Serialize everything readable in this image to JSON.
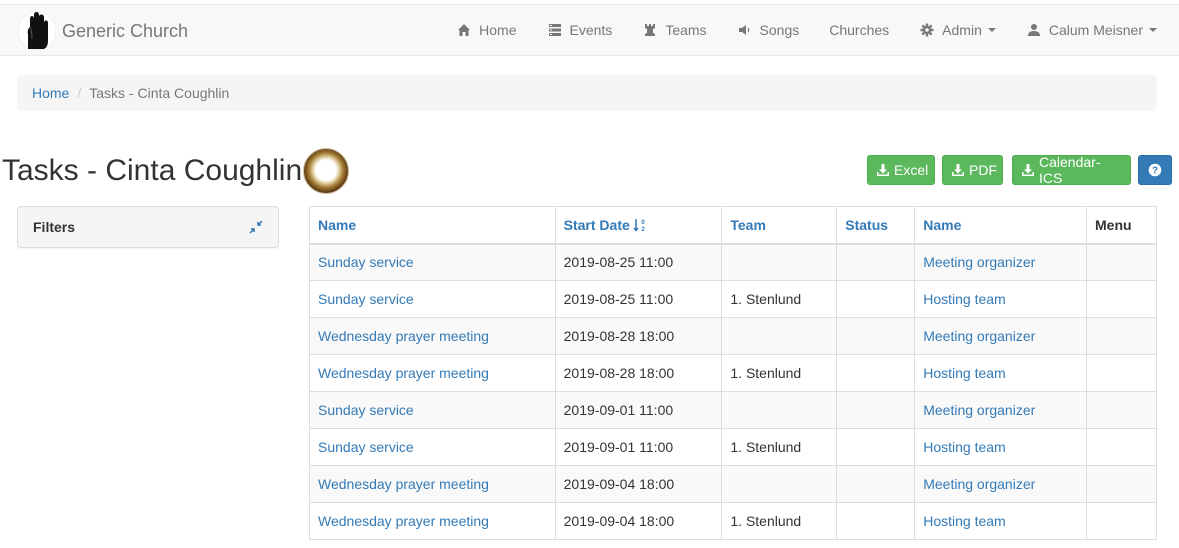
{
  "brand": {
    "name": "Generic Church"
  },
  "nav": {
    "items": [
      {
        "label": "Home",
        "icon": "home-icon"
      },
      {
        "label": "Events",
        "icon": "events-icon"
      },
      {
        "label": "Teams",
        "icon": "rook-icon"
      },
      {
        "label": "Songs",
        "icon": "volume-icon"
      },
      {
        "label": "Churches",
        "icon": ""
      },
      {
        "label": "Admin",
        "icon": "gear-icon"
      },
      {
        "label": "Calum Meisner",
        "icon": "user-icon"
      }
    ]
  },
  "breadcrumb": {
    "home": "Home",
    "current": "Tasks - Cinta Coughlin"
  },
  "page": {
    "title": "Tasks - Cinta Coughlin"
  },
  "buttons": {
    "excel": "Excel",
    "pdf": "PDF",
    "calendar": "Calendar-ICS",
    "help_icon": "question-icon"
  },
  "filters": {
    "title": "Filters",
    "icon": "compress-icon"
  },
  "table": {
    "headers": [
      "Name",
      "Start Date",
      "Team",
      "Status",
      "Name",
      "Menu"
    ],
    "rows": [
      [
        "Sunday service",
        "2019-08-25 11:00",
        "",
        "",
        "Meeting organizer",
        ""
      ],
      [
        "Sunday service",
        "2019-08-25 11:00",
        "1. Stenlund",
        "",
        "Hosting team",
        ""
      ],
      [
        "Wednesday prayer meeting",
        "2019-08-28 18:00",
        "",
        "",
        "Meeting organizer",
        ""
      ],
      [
        "Wednesday prayer meeting",
        "2019-08-28 18:00",
        "1. Stenlund",
        "",
        "Hosting team",
        ""
      ],
      [
        "Sunday service",
        "2019-09-01 11:00",
        "",
        "",
        "Meeting organizer",
        ""
      ],
      [
        "Sunday service",
        "2019-09-01 11:00",
        "1. Stenlund",
        "",
        "Hosting team",
        ""
      ],
      [
        "Wednesday prayer meeting",
        "2019-09-04 18:00",
        "",
        "",
        "Meeting organizer",
        ""
      ],
      [
        "Wednesday prayer meeting",
        "2019-09-04 18:00",
        "1. Stenlund",
        "",
        "Hosting team",
        ""
      ]
    ]
  },
  "colors": {
    "link": "#337ab7",
    "success": "#5cb85c",
    "primary": "#337ab7"
  }
}
